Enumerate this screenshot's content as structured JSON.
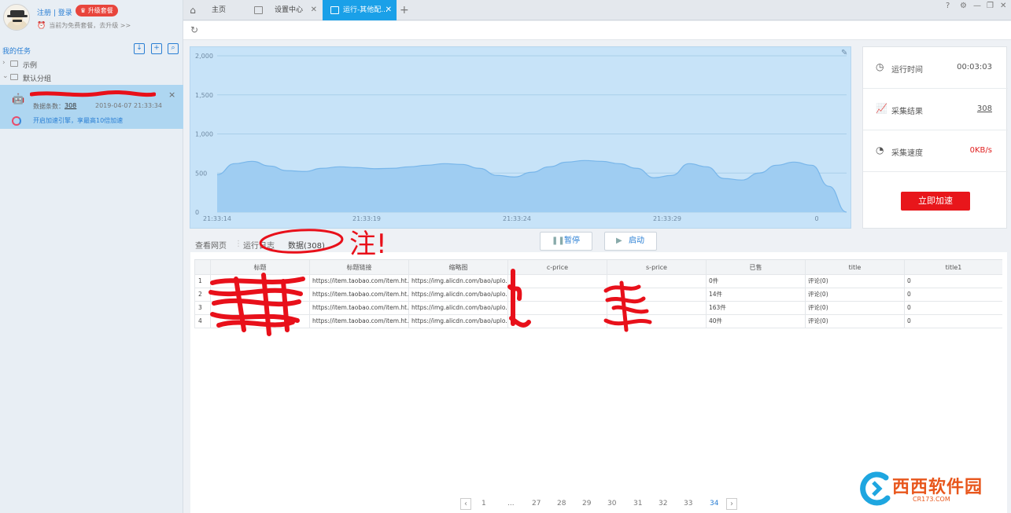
{
  "user": {
    "login_label": "注册 | 登录",
    "upgrade_label": "升级套餐",
    "plan_text": "当前为免费套餐，去升级 >>"
  },
  "sidebar": {
    "my_tasks_label": "我的任务",
    "groups": [
      {
        "label": "示例"
      },
      {
        "label": "默认分组"
      }
    ],
    "task": {
      "count_label": "数据条数：",
      "count_value": "308",
      "date": "2019-04-07 21:33:34",
      "accelerate_tip": "开启加速引擎，享最高10倍加速"
    }
  },
  "tabs": [
    {
      "label": "主页"
    },
    {
      "label": "设置中心"
    },
    {
      "label": "运行-其他配..."
    }
  ],
  "chart_data": {
    "type": "area",
    "x": [
      "21:33:14",
      "21:33:19",
      "21:33:24",
      "21:33:29",
      "0"
    ],
    "yticks": [
      "2,000",
      "1,500",
      "1,000",
      "500",
      "0"
    ],
    "ylim": [
      0,
      2000
    ],
    "grid": true,
    "series": [
      {
        "values": [
          480,
          620,
          650,
          590,
          530,
          520,
          560,
          580,
          570,
          555,
          560,
          580,
          600,
          620,
          610,
          560,
          470,
          450,
          510,
          580,
          640,
          660,
          650,
          620,
          560,
          440,
          470,
          620,
          580,
          430,
          410,
          500,
          600,
          640,
          600,
          330,
          0
        ]
      }
    ],
    "colors": {
      "fill": "#9fcdf2",
      "line": "#78b6ea",
      "background": "#c7e3f8"
    }
  },
  "stats": {
    "run_time_label": "运行时间",
    "run_time_value": "00:03:03",
    "results_label": "采集结果",
    "results_value": "308",
    "speed_label": "采集速度",
    "speed_value": "0KB/s",
    "boost_label": "立即加速"
  },
  "views": {
    "webpage": "查看网页",
    "log": "运行日志",
    "data": "数据(308)"
  },
  "controls": {
    "pause": "暂停",
    "start": "启动"
  },
  "table": {
    "columns": [
      "标题",
      "标题链接",
      "缩略图",
      "c-price",
      "s-price",
      "已售",
      "title",
      "title1"
    ],
    "rows": [
      {
        "idx": "1",
        "cells": [
          "",
          "https://item.taobao.com/item.ht...",
          "https://img.alicdn.com/bao/uplo...",
          "",
          "",
          "0件",
          "评论(0)",
          "0"
        ]
      },
      {
        "idx": "2",
        "cells": [
          "",
          "https://item.taobao.com/item.ht...",
          "https://img.alicdn.com/bao/uplo...",
          "",
          "",
          "14件",
          "评论(0)",
          "0"
        ]
      },
      {
        "idx": "3",
        "cells": [
          "",
          "https://item.taobao.com/item.ht...",
          "https://img.alicdn.com/bao/uplo...",
          "",
          "",
          "163件",
          "评论(0)",
          "0"
        ]
      },
      {
        "idx": "4",
        "cells": [
          "",
          "https://item.taobao.com/item.ht...",
          "https://img.alicdn.com/bao/uplo...",
          "",
          "",
          "40件",
          "评论(0)",
          "0"
        ]
      }
    ]
  },
  "pagination": {
    "pages": [
      "1",
      "...",
      "27",
      "28",
      "29",
      "30",
      "31",
      "32",
      "33",
      "34"
    ],
    "current": "34"
  },
  "annotation": {
    "note": "注!"
  },
  "watermark": {
    "title": "西西软件园",
    "subtitle": "CR173.COM"
  }
}
